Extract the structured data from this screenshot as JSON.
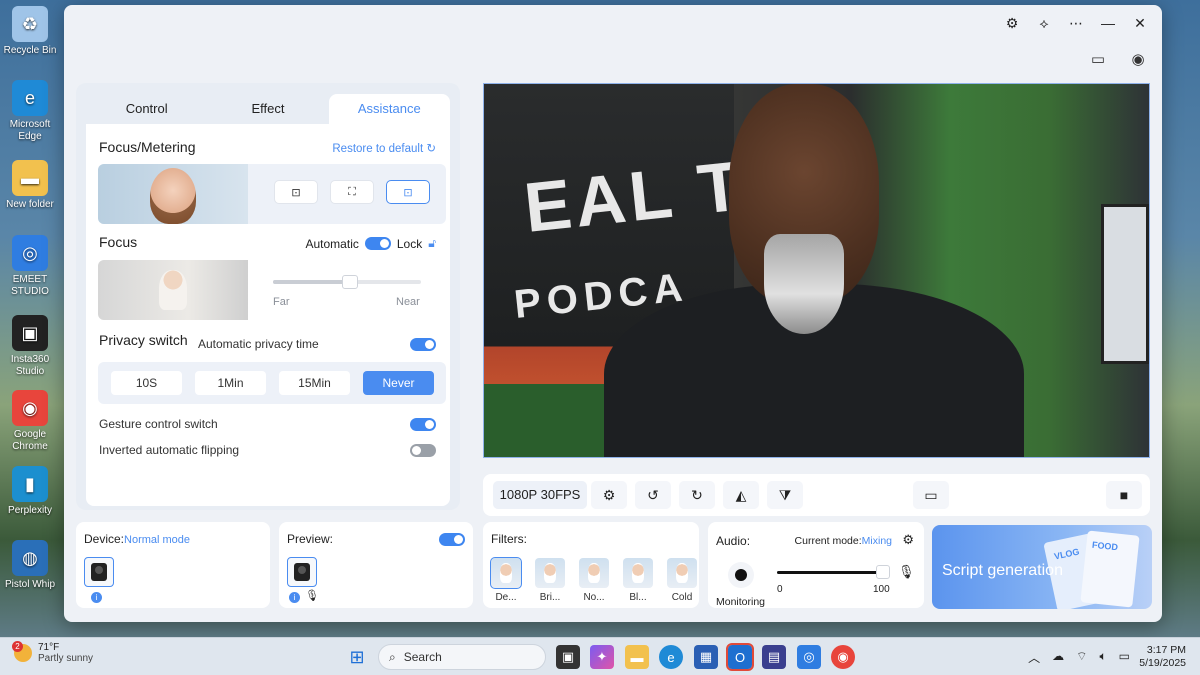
{
  "desktop": {
    "icons": [
      {
        "label": "Recycle Bin",
        "icon": "recycle-bin-icon",
        "color": "#9fc4e8"
      },
      {
        "label": "Microsoft Edge",
        "icon": "edge-icon",
        "color": "#1f8ad6"
      },
      {
        "label": "New folder",
        "icon": "folder-icon",
        "color": "#f2c14e"
      },
      {
        "label": "EMEET STUDIO",
        "icon": "emeet-studio-icon",
        "color": "#2f7de1"
      },
      {
        "label": "Insta360 Studio",
        "icon": "insta360-icon",
        "color": "#222222"
      },
      {
        "label": "Google Chrome",
        "icon": "chrome-icon",
        "color": "#e8453c"
      },
      {
        "label": "Perplexity",
        "icon": "perplexity-icon",
        "color": "#1c8fcf"
      },
      {
        "label": "Pistol Whip",
        "icon": "pistol-whip-icon",
        "color": "#2a6fb8"
      }
    ]
  },
  "tabs": [
    "Control",
    "Effect",
    "Assistance"
  ],
  "active_tab": 2,
  "focus_metering": {
    "title": "Focus/Metering",
    "restore_label": "Restore to default"
  },
  "focus": {
    "title": "Focus",
    "automatic_label": "Automatic",
    "lock_label": "Lock",
    "far_label": "Far",
    "near_label": "Near",
    "slider_value": 0.52
  },
  "privacy": {
    "title": "Privacy switch",
    "subtitle": "Automatic privacy time",
    "options": [
      "10S",
      "1Min",
      "15Min",
      "Never"
    ],
    "selected": "Never"
  },
  "gesture_label": "Gesture control switch",
  "inverted_label": "Inverted automatic flipping",
  "control_bar": {
    "resolution": "1080P 30FPS"
  },
  "device_card": {
    "label": "Device:",
    "mode": "Normal mode"
  },
  "preview_card": {
    "label": "Preview:"
  },
  "filters_card": {
    "label": "Filters:",
    "items": [
      "De...",
      "Bri...",
      "No...",
      "Bl...",
      "Cold"
    ]
  },
  "audio_card": {
    "label": "Audio:",
    "mode_label": "Current mode:",
    "mode_value": "Mixing",
    "monitoring_label": "Monitoring",
    "min": "0",
    "max": "100",
    "volume": 0.95
  },
  "script_card": {
    "label": "Script generation",
    "deco_1": "VLOG",
    "deco_2": "FOOD"
  },
  "video": {
    "banner_1": "EAL TA",
    "banner_2": "PODCA"
  },
  "taskbar": {
    "weather_temp": "71°F",
    "weather_desc": "Partly sunny",
    "weather_badge": "2",
    "search_label": "Search",
    "time": "3:17 PM",
    "date": "5/19/2025"
  },
  "colors": {
    "accent": "#4a8cf0"
  }
}
